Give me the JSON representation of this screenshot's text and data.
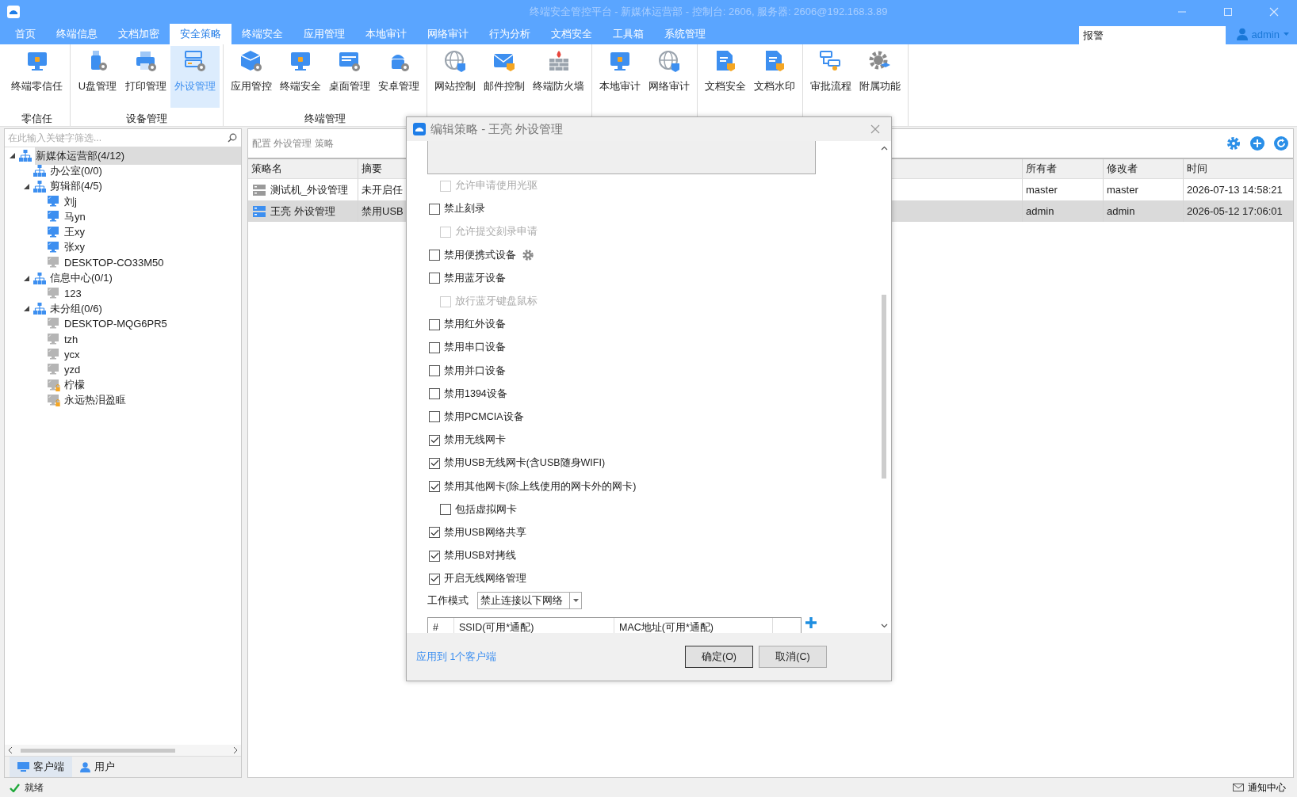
{
  "window": {
    "title": "终端安全管控平台 - 新媒体运营部 - 控制台: 2606, 服务器: 2606@192.168.3.89"
  },
  "menu": {
    "tabs": [
      {
        "label": "首页",
        "selected": false
      },
      {
        "label": "终端信息",
        "selected": false
      },
      {
        "label": "文档加密",
        "selected": false
      },
      {
        "label": "安全策略",
        "selected": true
      },
      {
        "label": "终端安全",
        "selected": false
      },
      {
        "label": "应用管理",
        "selected": false
      },
      {
        "label": "本地审计",
        "selected": false
      },
      {
        "label": "网络审计",
        "selected": false
      },
      {
        "label": "行为分析",
        "selected": false
      },
      {
        "label": "文档安全",
        "selected": false
      },
      {
        "label": "工具箱",
        "selected": false
      },
      {
        "label": "系统管理",
        "selected": false
      }
    ],
    "search": {
      "value": "报警"
    },
    "user": "admin"
  },
  "ribbon": {
    "groups": [
      {
        "label": "零信任",
        "buttons": [
          {
            "label": "终端零信任",
            "selected": false
          }
        ]
      },
      {
        "label": "设备管理",
        "buttons": [
          {
            "label": "U盘管理",
            "selected": false
          },
          {
            "label": "打印管理",
            "selected": false
          },
          {
            "label": "外设管理",
            "selected": true
          }
        ]
      },
      {
        "label": "终端管理",
        "buttons": [
          {
            "label": "应用管控",
            "selected": false
          },
          {
            "label": "终端安全",
            "selected": false
          },
          {
            "label": "桌面管理",
            "selected": false
          },
          {
            "label": "安卓管理",
            "selected": false
          }
        ]
      },
      {
        "buttons": [
          {
            "label": "网站控制",
            "selected": false
          },
          {
            "label": "邮件控制",
            "selected": false
          },
          {
            "label": "终端防火墙",
            "selected": false
          }
        ]
      },
      {
        "buttons": [
          {
            "label": "本地审计",
            "selected": false
          },
          {
            "label": "网络审计",
            "selected": false
          }
        ]
      },
      {
        "buttons": [
          {
            "label": "文档安全",
            "selected": false
          },
          {
            "label": "文档水印",
            "selected": false
          }
        ]
      },
      {
        "buttons": [
          {
            "label": "审批流程",
            "selected": false
          },
          {
            "label": "附属功能",
            "selected": false
          }
        ]
      }
    ]
  },
  "sidebar": {
    "filter": {
      "placeholder": "在此输入关键字筛选..."
    },
    "tree": [
      {
        "kind": "group",
        "label": "新媒体运营部(4/12)",
        "selected": true,
        "expanded": true,
        "children": [
          {
            "kind": "group",
            "label": "办公室(0/0)",
            "selected": false
          },
          {
            "kind": "group",
            "label": "剪辑部(4/5)",
            "selected": false,
            "expanded": true,
            "children": [
              {
                "kind": "computer",
                "label": "刘j",
                "selected": false,
                "online": true
              },
              {
                "kind": "computer",
                "label": "马yn",
                "selected": false,
                "online": true
              },
              {
                "kind": "computer",
                "label": "王xy",
                "selected": false,
                "online": true
              },
              {
                "kind": "computer",
                "label": "张xy",
                "selected": false,
                "online": true
              },
              {
                "kind": "computer",
                "label": "DESKTOP-CO33M50",
                "selected": false,
                "online": false
              }
            ]
          },
          {
            "kind": "group",
            "label": "信息中心(0/1)",
            "selected": false,
            "expanded": true,
            "children": [
              {
                "kind": "computer",
                "label": "123",
                "selected": false,
                "online": false
              }
            ]
          },
          {
            "kind": "group",
            "label": "未分组(0/6)",
            "selected": false,
            "expanded": true,
            "children": [
              {
                "kind": "computer",
                "label": "DESKTOP-MQG6PR5",
                "selected": false,
                "online": false
              },
              {
                "kind": "computer",
                "label": "tzh",
                "selected": false,
                "online": false
              },
              {
                "kind": "computer",
                "label": "ycx",
                "selected": false,
                "online": false
              },
              {
                "kind": "computer",
                "label": "yzd",
                "selected": false,
                "online": false
              },
              {
                "kind": "computer",
                "label": "柠檬",
                "selected": false,
                "online": false,
                "locked": true
              },
              {
                "kind": "computer",
                "label": "永远热泪盈眶",
                "selected": false,
                "online": false,
                "locked": true
              }
            ]
          }
        ]
      }
    ],
    "tabs": [
      {
        "label": "客户端",
        "selected": true
      },
      {
        "label": "用户",
        "selected": false
      }
    ]
  },
  "policies": {
    "heading": "配置 外设管理 策略",
    "columns": [
      "策略名",
      "摘要",
      "所有者",
      "修改者",
      "时间"
    ],
    "rows": [
      {
        "name": "测试机_外设管理",
        "summary": "未开启任",
        "owner": "master",
        "modifier": "master",
        "time": "2026-07-13 14:58:21",
        "selected": false
      },
      {
        "name": "王亮 外设管理",
        "summary": "禁用USB",
        "owner": "admin",
        "modifier": "admin",
        "time": "2026-05-12 17:06:01",
        "selected": true
      }
    ]
  },
  "dialog": {
    "title": "编辑策略 - 王亮 外设管理",
    "options": [
      {
        "kind": "textbox"
      },
      {
        "kind": "continuation",
        "children": [
          {
            "kind": "checkbox",
            "label": "允许申请使用光驱",
            "checked": false,
            "disabled": true
          }
        ]
      },
      {
        "kind": "checkbox",
        "label": "禁止刻录",
        "checked": false,
        "disabled": false,
        "children": [
          {
            "kind": "checkbox",
            "label": "允许提交刻录申请",
            "checked": false,
            "disabled": true
          }
        ]
      },
      {
        "kind": "checkbox",
        "label": "禁用便携式设备",
        "checked": false,
        "disabled": false,
        "settings": true
      },
      {
        "kind": "checkbox",
        "label": "禁用蓝牙设备",
        "checked": false,
        "disabled": false,
        "children": [
          {
            "kind": "checkbox",
            "label": "放行蓝牙键盘鼠标",
            "checked": false,
            "disabled": true
          }
        ]
      },
      {
        "kind": "checkbox",
        "label": "禁用红外设备",
        "checked": false,
        "disabled": false
      },
      {
        "kind": "checkbox",
        "label": "禁用串口设备",
        "checked": false,
        "disabled": false
      },
      {
        "kind": "checkbox",
        "label": "禁用并口设备",
        "checked": false,
        "disabled": false
      },
      {
        "kind": "checkbox",
        "label": "禁用1394设备",
        "checked": false,
        "disabled": false
      },
      {
        "kind": "checkbox",
        "label": "禁用PCMCIA设备",
        "checked": false,
        "disabled": false
      },
      {
        "kind": "checkbox",
        "label": "禁用无线网卡",
        "checked": true,
        "disabled": false
      },
      {
        "kind": "checkbox",
        "label": "禁用USB无线网卡(含USB随身WIFI)",
        "checked": true,
        "disabled": false
      },
      {
        "kind": "checkbox",
        "label": "禁用其他网卡(除上线使用的网卡外的网卡)",
        "checked": true,
        "disabled": false,
        "children": [
          {
            "kind": "checkbox",
            "label": "包括虚拟网卡",
            "checked": false,
            "disabled": false
          }
        ]
      },
      {
        "kind": "checkbox",
        "label": "禁用USB网络共享",
        "checked": true,
        "disabled": false
      },
      {
        "kind": "checkbox",
        "label": "禁用USB对拷线",
        "checked": true,
        "disabled": false
      },
      {
        "kind": "checkbox",
        "label": "开启无线网络管理",
        "checked": true,
        "disabled": false
      }
    ],
    "work_mode": {
      "label": "工作模式",
      "value": "禁止连接以下网络"
    },
    "network_table": {
      "columns": [
        "#",
        "SSID(可用*通配)",
        "MAC地址(可用*通配)"
      ]
    },
    "apply_link": "应用到 1个客户端",
    "buttons": [
      "确定(O)",
      "取消(C)"
    ]
  },
  "status_bar": {
    "text": "就绪",
    "notifications": "通知中心"
  }
}
